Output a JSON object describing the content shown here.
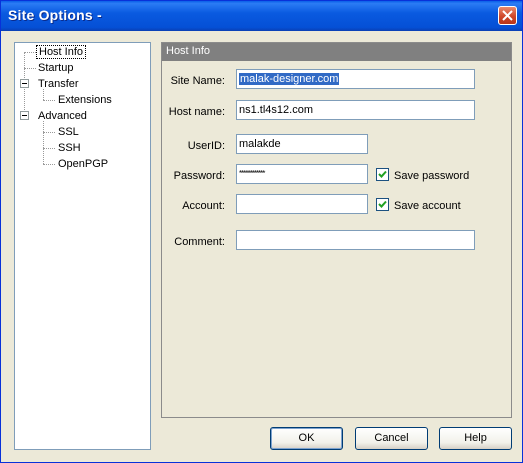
{
  "window": {
    "title": "Site Options -"
  },
  "tree": {
    "items": [
      {
        "label": "Host Info"
      },
      {
        "label": "Startup"
      },
      {
        "label": "Transfer"
      },
      {
        "label": "Extensions"
      },
      {
        "label": "Advanced"
      },
      {
        "label": "SSL"
      },
      {
        "label": "SSH"
      },
      {
        "label": "OpenPGP"
      }
    ]
  },
  "panel": {
    "header": "Host Info",
    "site_name": {
      "label": "Site Name:",
      "value": "malak-designer.com"
    },
    "host_name": {
      "label": "Host name:",
      "value": "ns1.tl4s12.com"
    },
    "user_id": {
      "label": "UserID:",
      "value": "malakde"
    },
    "password": {
      "label": "Password:",
      "value": "************"
    },
    "account": {
      "label": "Account:",
      "value": ""
    },
    "comment": {
      "label": "Comment:",
      "value": ""
    },
    "save_password": {
      "label": "Save password",
      "checked": true
    },
    "save_account": {
      "label": "Save account",
      "checked": true
    }
  },
  "buttons": {
    "ok": "OK",
    "cancel": "Cancel",
    "help": "Help"
  }
}
